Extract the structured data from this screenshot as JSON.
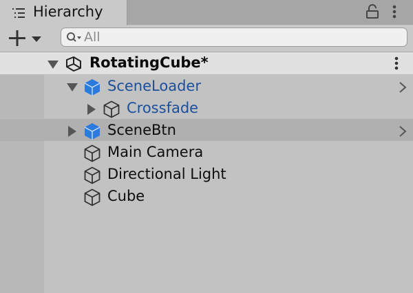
{
  "window": {
    "tab_label": "Hierarchy"
  },
  "toolbar": {
    "add_label": "+",
    "search_placeholder": "All"
  },
  "scene": {
    "title": "RotatingCube*"
  },
  "items": [
    {
      "label": "SceneLoader",
      "kind": "prefab",
      "expanded": true
    },
    {
      "label": "Crossfade",
      "kind": "prefab",
      "expanded": false
    },
    {
      "label": "SceneBtn",
      "kind": "prefab",
      "expanded": false
    },
    {
      "label": "Main Camera",
      "kind": "gameobject"
    },
    {
      "label": "Directional Light",
      "kind": "gameobject"
    },
    {
      "label": "Cube",
      "kind": "gameobject"
    }
  ],
  "colors": {
    "prefab_text": "#1b4f9c",
    "prefab_icon": "#2b7ae0",
    "panel_bg": "#c2c2c2"
  }
}
